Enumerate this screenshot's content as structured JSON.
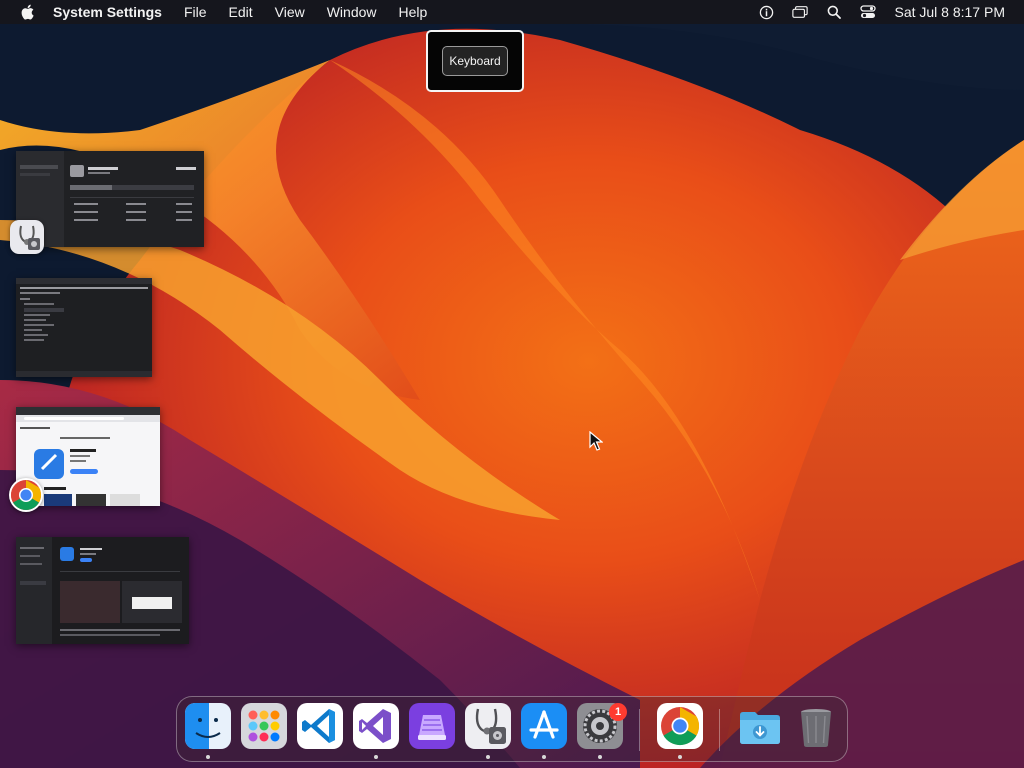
{
  "menubar": {
    "app_name": "System Settings",
    "menus": [
      "File",
      "Edit",
      "View",
      "Window",
      "Help"
    ],
    "clock": "Sat Jul 8  8:17 PM",
    "status_icons": [
      "accessibility-icon",
      "screen-mirroring-icon",
      "spotlight-search-icon",
      "control-center-icon"
    ]
  },
  "hud": {
    "label": "Keyboard"
  },
  "stage_manager": {
    "windows": [
      {
        "app": "disk-utility-icon"
      },
      {
        "app": "terminal"
      },
      {
        "app": "chrome-icon"
      },
      {
        "app": "app-store"
      }
    ]
  },
  "dock": {
    "items": [
      "finder",
      "launchpad",
      "visual-studio-code",
      "visual-studio",
      "simulator",
      "disk-utility",
      "app-store",
      "system-settings",
      "google-chrome",
      "downloads",
      "trash"
    ],
    "system_settings_badge": "1"
  },
  "colors": {
    "menubar": "#16161c",
    "wallpaper_orange": "#f36a1c",
    "wallpaper_red": "#b31f23",
    "wallpaper_dark": "#0d1a30",
    "badge_red": "#ff3b30"
  }
}
